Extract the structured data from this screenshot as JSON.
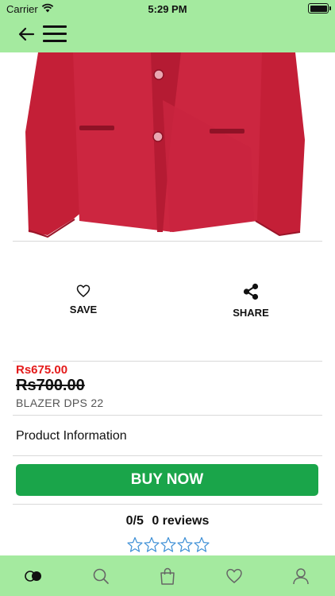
{
  "status_bar": {
    "carrier": "Carrier",
    "time": "5:29 PM"
  },
  "header": {
    "back_icon": "arrow-left-icon",
    "menu_icon": "hamburger-menu-icon",
    "background_color": "#a4ea9f"
  },
  "actions": {
    "save_label": "SAVE",
    "share_label": "SHARE"
  },
  "product": {
    "sale_price": "Rs675.00",
    "original_price": "Rs700.00",
    "name": "BLAZER DPS 22",
    "info_label": "Product Information",
    "image_color": "#c6223a"
  },
  "buy": {
    "label": "BUY NOW",
    "color": "#1aa54a"
  },
  "rating": {
    "score": "0/5",
    "reviews": "0 reviews",
    "stars_filled": 0,
    "stars_total": 5
  },
  "tabbar": {
    "items": [
      {
        "icon": "toggle-icon"
      },
      {
        "icon": "search-icon"
      },
      {
        "icon": "shopping-bag-icon"
      },
      {
        "icon": "heart-icon"
      },
      {
        "icon": "user-icon"
      }
    ]
  }
}
